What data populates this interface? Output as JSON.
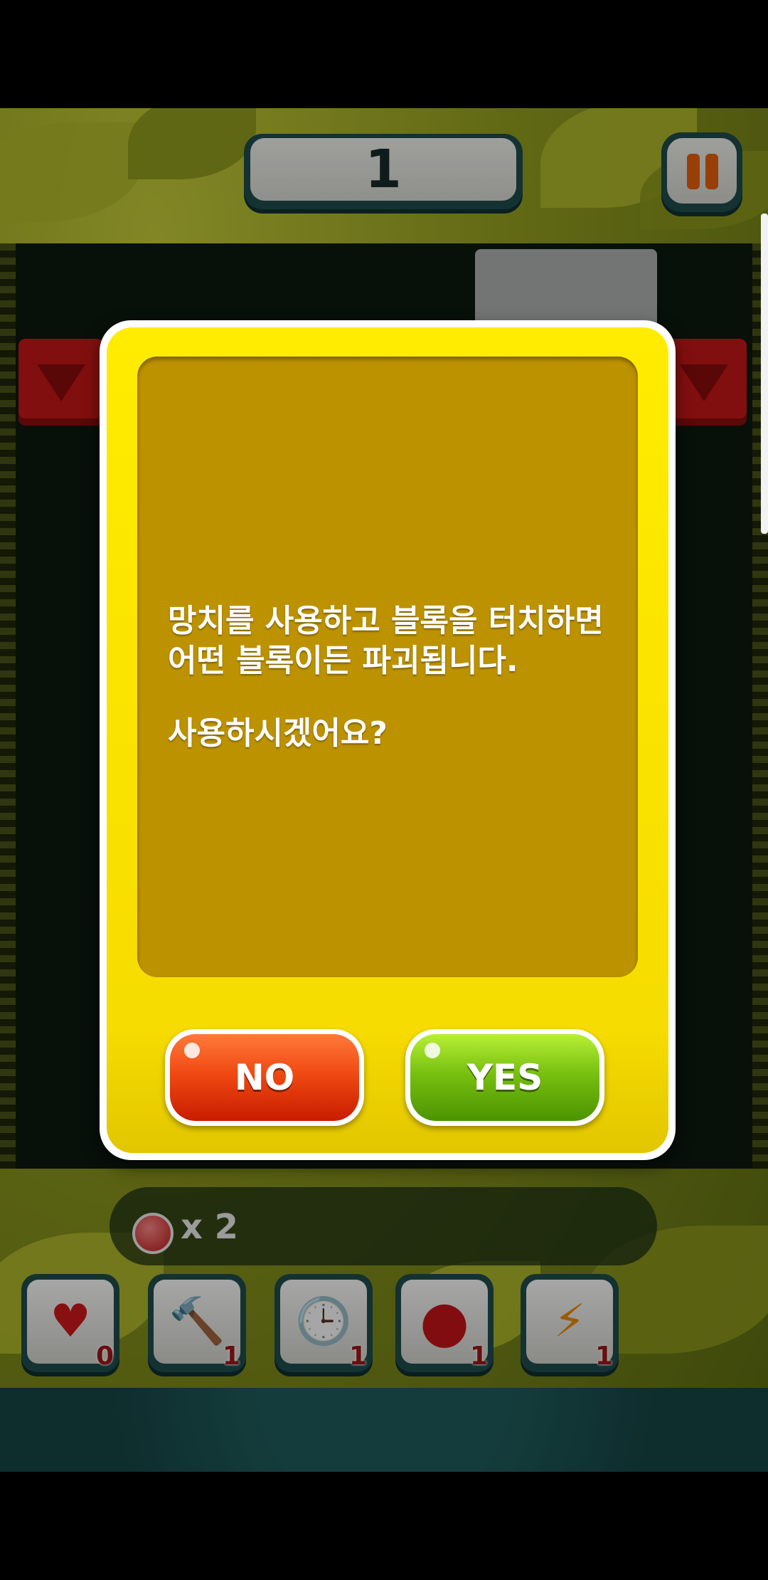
{
  "header": {
    "score": "1",
    "pause_icon": "pause-icon"
  },
  "hud": {
    "bomb_count": "x 2",
    "bomb_icon": "red-bomb-icon",
    "items": [
      {
        "icon": "heart-box-icon",
        "glyph": "♥",
        "count": "0"
      },
      {
        "icon": "hammer-icon",
        "glyph": "🔨",
        "count": "1"
      },
      {
        "icon": "clock-icon",
        "glyph": "🕒",
        "count": "1"
      },
      {
        "icon": "red-bomb-pair-icon",
        "glyph": "●",
        "count": "1"
      },
      {
        "icon": "lightning-icon",
        "glyph": "⚡",
        "count": "1"
      }
    ]
  },
  "dialog": {
    "line1": "망치를 사용하고 블록을 터치하면",
    "line2": "어떤 블록이든 파괴됩니다.",
    "line3": "사용하시겠어요?",
    "no_label": "NO",
    "yes_label": "YES"
  },
  "colors": {
    "dialog_yellow": "#ffec00",
    "panel_gold": "#bd9200",
    "no_red": "#f04a12",
    "yes_green": "#78c010"
  }
}
